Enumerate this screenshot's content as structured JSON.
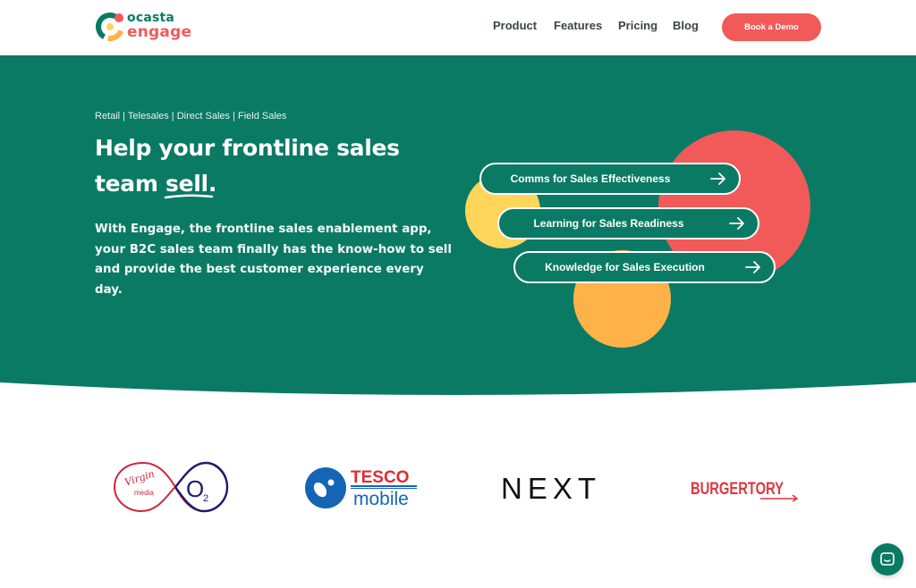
{
  "brand": {
    "name_line1": "ocasta",
    "name_line2": "engage",
    "colors": {
      "teal": "#0b7a65",
      "coral": "#f25a5a",
      "yellow": "#ffd55a",
      "orange": "#ffb248"
    }
  },
  "nav": {
    "items": [
      {
        "label": "Product"
      },
      {
        "label": "Features"
      },
      {
        "label": "Pricing"
      },
      {
        "label": "Blog"
      }
    ],
    "cta_label": "Book a Demo"
  },
  "hero": {
    "eyebrow": "Retail | Telesales | Direct Sales | Field Sales",
    "headline_part1": "Help your frontline sales team",
    "headline_emphasis": "sell",
    "headline_end": ".",
    "lead": "With Engage, the frontline sales enablement app, your B2C sales team finally has the know-how to sell and provide the best customer experience every day.",
    "pills": [
      {
        "label": "Comms for Sales Effectiveness",
        "icon": "arrow-right-icon"
      },
      {
        "label": "Learning for Sales Readiness",
        "icon": "arrow-right-icon"
      },
      {
        "label": "Knowledge for Sales Execution",
        "icon": "arrow-right-icon"
      }
    ]
  },
  "customers": {
    "logos": [
      {
        "name": "Virgin Media O2",
        "text_a": "Virgin",
        "text_b": "media",
        "text_c": "O",
        "text_d": "2"
      },
      {
        "name": "Tesco Mobile",
        "text_a": "TESCO",
        "text_b": "mobile"
      },
      {
        "name": "NEXT",
        "text_a": "NEXT"
      },
      {
        "name": "Burger Tory",
        "text_a": "BURGERTORY"
      }
    ]
  },
  "chat": {
    "icon": "chat-icon"
  }
}
